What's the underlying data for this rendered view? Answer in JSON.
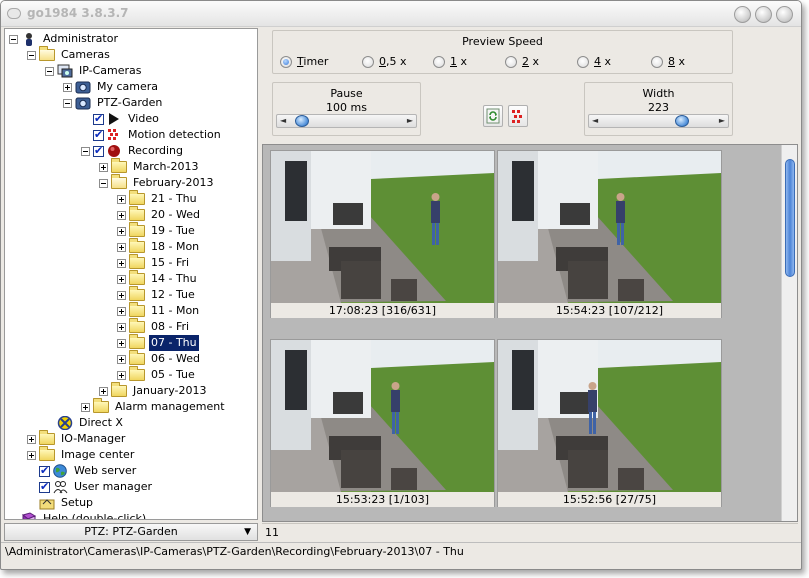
{
  "window": {
    "title": "go1984 3.8.3.7"
  },
  "tree": {
    "items": [
      {
        "label": "Administrator",
        "level": 0,
        "icon": "admin-icon",
        "expander": "minus"
      },
      {
        "label": "Cameras",
        "level": 1,
        "icon": "folder-open-icon",
        "expander": "minus"
      },
      {
        "label": "IP-Cameras",
        "level": 2,
        "icon": "network-camera-icon",
        "expander": "minus"
      },
      {
        "label": "My camera",
        "level": 3,
        "icon": "camera-icon",
        "expander": "plus"
      },
      {
        "label": "PTZ-Garden",
        "level": 3,
        "icon": "camera-icon",
        "expander": "minus"
      },
      {
        "label": "Video",
        "level": 4,
        "icon": "play-icon",
        "check": true
      },
      {
        "label": "Motion detection",
        "level": 4,
        "icon": "motion-icon",
        "check": true
      },
      {
        "label": "Recording",
        "level": 4,
        "icon": "record-icon",
        "check": true,
        "expander": "minus"
      },
      {
        "label": "March-2013",
        "level": 5,
        "icon": "folder-icon",
        "expander": "plus"
      },
      {
        "label": "February-2013",
        "level": 5,
        "icon": "folder-open-icon",
        "expander": "minus"
      },
      {
        "label": "21 - Thu",
        "level": 6,
        "icon": "folder-icon",
        "expander": "plus"
      },
      {
        "label": "20 - Wed",
        "level": 6,
        "icon": "folder-icon",
        "expander": "plus"
      },
      {
        "label": "19 - Tue",
        "level": 6,
        "icon": "folder-icon",
        "expander": "plus"
      },
      {
        "label": "18 - Mon",
        "level": 6,
        "icon": "folder-icon",
        "expander": "plus"
      },
      {
        "label": "15 - Fri",
        "level": 6,
        "icon": "folder-icon",
        "expander": "plus"
      },
      {
        "label": "14 - Thu",
        "level": 6,
        "icon": "folder-icon",
        "expander": "plus"
      },
      {
        "label": "12 - Tue",
        "level": 6,
        "icon": "folder-icon",
        "expander": "plus"
      },
      {
        "label": "11 - Mon",
        "level": 6,
        "icon": "folder-icon",
        "expander": "plus"
      },
      {
        "label": "08 - Fri",
        "level": 6,
        "icon": "folder-icon",
        "expander": "plus"
      },
      {
        "label": "07 - Thu",
        "level": 6,
        "icon": "folder-icon",
        "expander": "plus",
        "selected": true
      },
      {
        "label": "06 - Wed",
        "level": 6,
        "icon": "folder-icon",
        "expander": "plus"
      },
      {
        "label": "05 - Tue",
        "level": 6,
        "icon": "folder-icon",
        "expander": "plus"
      },
      {
        "label": "January-2013",
        "level": 5,
        "icon": "folder-icon",
        "expander": "plus"
      },
      {
        "label": "Alarm management",
        "level": 4,
        "icon": "folder-icon",
        "expander": "plus"
      },
      {
        "label": "Direct X",
        "level": 2,
        "icon": "directx-icon"
      },
      {
        "label": "IO-Manager",
        "level": 1,
        "icon": "folder-icon",
        "expander": "plus"
      },
      {
        "label": "Image center",
        "level": 1,
        "icon": "folder-icon",
        "expander": "plus"
      },
      {
        "label": "Web server",
        "level": 1,
        "icon": "globe-icon",
        "check": true
      },
      {
        "label": "User manager",
        "level": 1,
        "icon": "users-icon",
        "check": true
      },
      {
        "label": "Setup",
        "level": 1,
        "icon": "setup-icon"
      },
      {
        "label": "Help (double-click)",
        "level": 0,
        "icon": "help-book-icon"
      }
    ]
  },
  "camera_select": {
    "value": "PTZ: PTZ-Garden"
  },
  "preview_speed": {
    "title": "Preview Speed",
    "options": [
      {
        "label": "Timer",
        "hotkey": "T",
        "rest": "imer",
        "checked": true
      },
      {
        "label": "0,5 x",
        "hotkey": "0",
        "rest": ",5 x",
        "checked": false
      },
      {
        "label": "1 x",
        "hotkey": "1",
        "rest": " x",
        "checked": false
      },
      {
        "label": "2 x",
        "hotkey": "2",
        "rest": " x",
        "checked": false
      },
      {
        "label": "4 x",
        "hotkey": "4",
        "rest": " x",
        "checked": false
      },
      {
        "label": "8 x",
        "hotkey": "8",
        "rest": " x",
        "checked": false
      }
    ]
  },
  "pause": {
    "title": "Pause",
    "value": "100 ms",
    "slider_fraction": 0.02
  },
  "width": {
    "title": "Width",
    "value": "223",
    "slider_fraction": 0.75
  },
  "toolbar": {
    "refresh_icon": "refresh-icon",
    "motion_icon": "motion-grid-icon"
  },
  "thumbnails": [
    {
      "caption": "17:08:23 [316/631]"
    },
    {
      "caption": "15:54:23 [107/212]"
    },
    {
      "caption": "15:53:23 [1/103]"
    },
    {
      "caption": "15:52:56 [27/75]"
    }
  ],
  "frame_field": {
    "value": "11"
  },
  "status": {
    "path": "\\Administrator\\Cameras\\IP-Cameras\\PTZ-Garden\\Recording\\February-2013\\07 - Thu"
  },
  "colors": {
    "selection": "#0a246a",
    "accent": "#4b83d7",
    "grass": "#5d8b36"
  }
}
